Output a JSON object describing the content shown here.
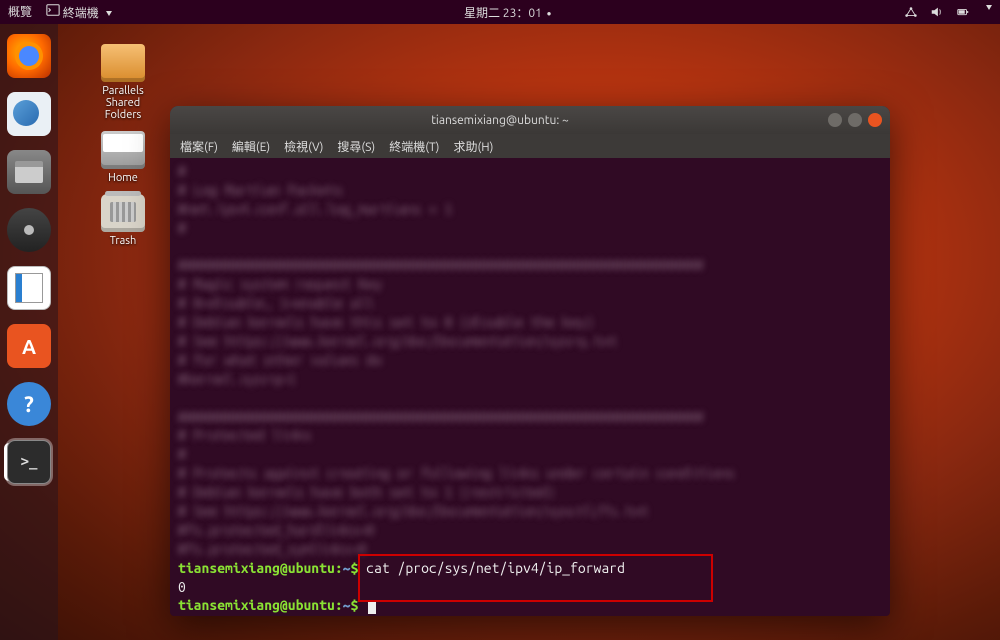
{
  "topbar": {
    "overview": "概覽",
    "app": "終端機",
    "datetime": "星期二 23：01",
    "dot": "●"
  },
  "desktop": {
    "parallels": "Parallels\nShared\nFolders",
    "home": "Home",
    "trash": "Trash"
  },
  "terminal": {
    "title": "tiansemixiang@ubuntu: ~",
    "menu": {
      "file": "檔案(F)",
      "edit": "編輯(E)",
      "view": "檢視(V)",
      "search": "搜尋(S)",
      "terminal": "終端機(T)",
      "help": "求助(H)"
    },
    "blur_lines": [
      "#",
      "# Log Martian Packets",
      "#net.ipv4.conf.all.log_martians = 1",
      "#",
      "",
      "###################################################################",
      "# Magic system request Key",
      "# 0=disable, 1=enable all",
      "# Debian kernels have this set to 0 (disable the key)",
      "# See https://www.kernel.org/doc/Documentation/sysrq.txt",
      "# for what other values do",
      "#kernel.sysrq=1",
      "",
      "###################################################################",
      "# Protected links",
      "#",
      "# Protects against creating or following links under certain conditions",
      "# Debian kernels have both set to 1 (restricted)",
      "# See https://www.kernel.org/doc/Documentation/sysctl/fs.txt",
      "#fs.protected_hardlinks=0",
      "#fs.protected_symlinks=0"
    ],
    "prompt_user": "tiansemixiang@ubuntu",
    "prompt_sep": ":",
    "prompt_path": "~",
    "prompt_dollar": "$",
    "cmd1": " cat  /proc/sys/net/ipv4/ip_forward",
    "out1": "0",
    "cmd2": " "
  }
}
